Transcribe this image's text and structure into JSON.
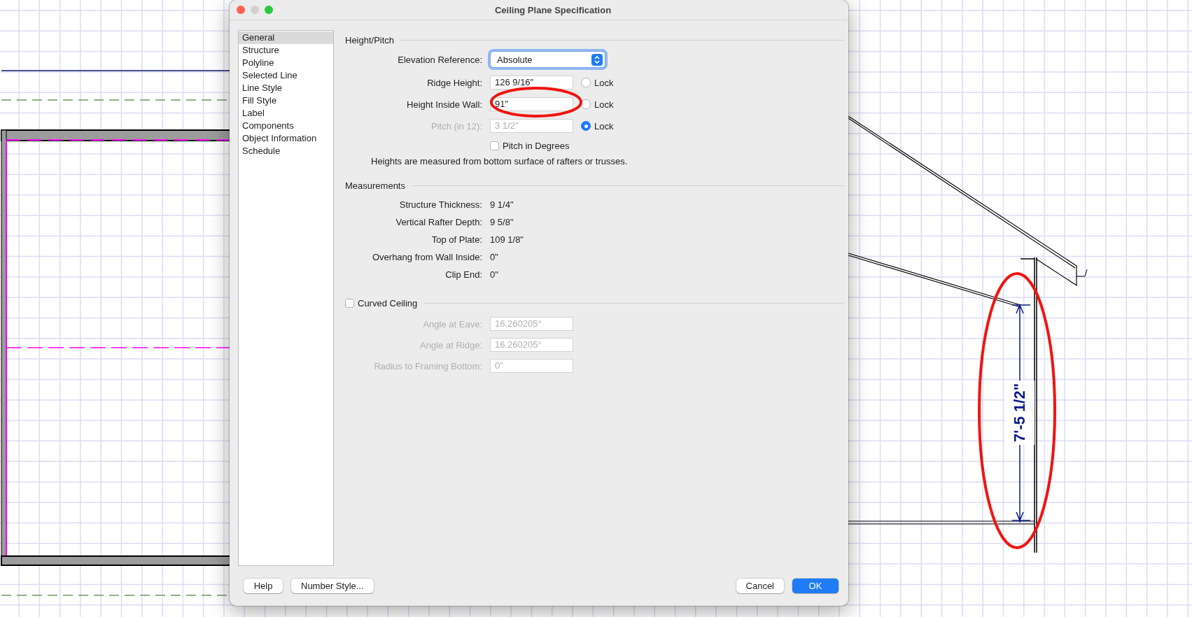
{
  "window": {
    "title": "Ceiling Plane Specification"
  },
  "sidebar": {
    "items": [
      {
        "label": "General",
        "selected": true
      },
      {
        "label": "Structure",
        "selected": false
      },
      {
        "label": "Polyline",
        "selected": false
      },
      {
        "label": "Selected Line",
        "selected": false
      },
      {
        "label": "Line Style",
        "selected": false
      },
      {
        "label": "Fill Style",
        "selected": false
      },
      {
        "label": "Label",
        "selected": false
      },
      {
        "label": "Components",
        "selected": false
      },
      {
        "label": "Object Information",
        "selected": false
      },
      {
        "label": "Schedule",
        "selected": false
      }
    ]
  },
  "height_pitch": {
    "heading": "Height/Pitch",
    "elevation_reference": {
      "label": "Elevation Reference:",
      "value": "Absolute"
    },
    "fields": [
      {
        "label": "Ridge Height:",
        "value": "126 9/16\"",
        "disabled": false,
        "lock": {
          "label": "Lock",
          "selected": false
        }
      },
      {
        "label": "Height Inside Wall:",
        "value": "91\"",
        "disabled": false,
        "lock": {
          "label": "Lock",
          "selected": false
        }
      },
      {
        "label": "Pitch (in 12):",
        "value": "3 1/2\"",
        "disabled": true,
        "lock": {
          "label": "Lock",
          "selected": true
        }
      }
    ],
    "pitch_in_degrees": {
      "label": "Pitch in Degrees",
      "checked": false
    },
    "note": "Heights are measured from bottom surface of rafters or trusses."
  },
  "measurements": {
    "heading": "Measurements",
    "rows": [
      {
        "label": "Structure Thickness:",
        "value": "9 1/4\""
      },
      {
        "label": "Vertical Rafter Depth:",
        "value": "9 5/8\""
      },
      {
        "label": "Top of Plate:",
        "value": "109 1/8\""
      },
      {
        "label": "Overhang from Wall Inside:",
        "value": "0\""
      },
      {
        "label": "Clip End:",
        "value": "0\""
      }
    ]
  },
  "curved_ceiling": {
    "label": "Curved Ceiling",
    "checked": false,
    "fields": [
      {
        "label": "Angle at Eave:",
        "value": "16.260205°",
        "disabled": true
      },
      {
        "label": "Angle at Ridge:",
        "value": "16.260205°",
        "disabled": true
      },
      {
        "label": "Radius to Framing Bottom:",
        "value": "0\"",
        "disabled": true
      }
    ]
  },
  "buttons": [
    {
      "label": "Help",
      "kind": "secondary"
    },
    {
      "label": "Number Style...",
      "kind": "secondary"
    },
    {
      "label": "Cancel",
      "kind": "secondary"
    },
    {
      "label": "OK",
      "kind": "default"
    }
  ],
  "drawing": {
    "dimension_label": "7'-5 1/2\""
  }
}
